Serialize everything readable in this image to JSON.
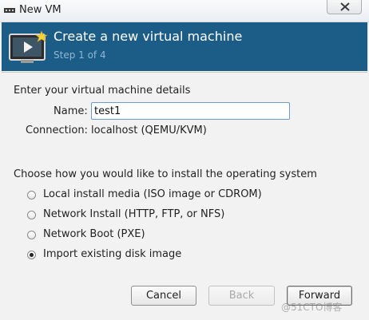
{
  "window": {
    "title": "New VM"
  },
  "banner": {
    "title": "Create a new virtual machine",
    "step": "Step 1 of 4"
  },
  "details": {
    "heading": "Enter your virtual machine details",
    "name_label": "Name:",
    "name_value": "test1",
    "connection_label": "Connection:",
    "connection_value": "localhost (QEMU/KVM)"
  },
  "install": {
    "heading": "Choose how you would like to install the operating system",
    "options": [
      {
        "label": "Local install media (ISO image or CDROM)",
        "selected": false
      },
      {
        "label": "Network Install (HTTP, FTP, or NFS)",
        "selected": false
      },
      {
        "label": "Network Boot (PXE)",
        "selected": false
      },
      {
        "label": "Import existing disk image",
        "selected": true
      }
    ]
  },
  "buttons": {
    "cancel": "Cancel",
    "back": "Back",
    "forward": "Forward"
  },
  "watermark": "@51CTO博客",
  "colors": {
    "banner_bg": "#1c5d88",
    "banner_step_text": "#8fb5d2",
    "input_border": "#6d9ad1"
  },
  "icons": {
    "titlebar": "vm-manager-icon",
    "close": "close-icon",
    "banner": "vm-screen-star-icon"
  }
}
